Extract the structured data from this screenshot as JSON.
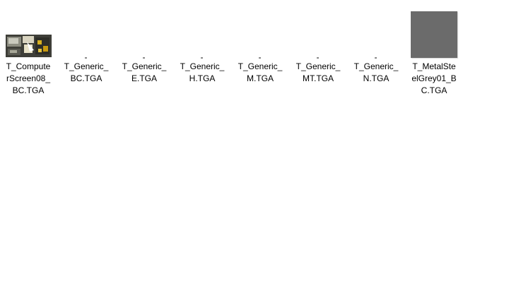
{
  "files": [
    {
      "name": "T_ComputerScreen08_\nBC.TGA",
      "name_lines": "T_Compute\nrScreen08_\nBC.TGA",
      "thumbnail": "computer-screen-image",
      "selected": false
    },
    {
      "name": "T_Generic_BC.TGA",
      "name_lines": "T_Generic_\nBC.TGA",
      "thumbnail": "tiny-dot",
      "selected": false
    },
    {
      "name": "T_Generic_E.TGA",
      "name_lines": "T_Generic_\nE.TGA",
      "thumbnail": "tiny-dot",
      "selected": false
    },
    {
      "name": "T_Generic_H.TGA",
      "name_lines": "T_Generic_\nH.TGA",
      "thumbnail": "tiny-dot",
      "selected": false
    },
    {
      "name": "T_Generic_M.TGA",
      "name_lines": "T_Generic_\nM.TGA",
      "thumbnail": "tiny-dot",
      "selected": false
    },
    {
      "name": "T_Generic_MT.TGA",
      "name_lines": "T_Generic_\nMT.TGA",
      "thumbnail": "tiny-dot",
      "selected": false
    },
    {
      "name": "T_Generic_N.TGA",
      "name_lines": "T_Generic_\nN.TGA",
      "thumbnail": "tiny-dot",
      "selected": false
    },
    {
      "name": "T_MetalSteelGrey01_BC.TGA",
      "name_lines": "T_MetalSte\nelGrey01_B\nC.TGA",
      "thumbnail": "grey-metal-texture",
      "selected": false
    }
  ],
  "colors": {
    "background": "#ffffff",
    "text": "#000000",
    "metal_grey": "#6b6b6b"
  }
}
